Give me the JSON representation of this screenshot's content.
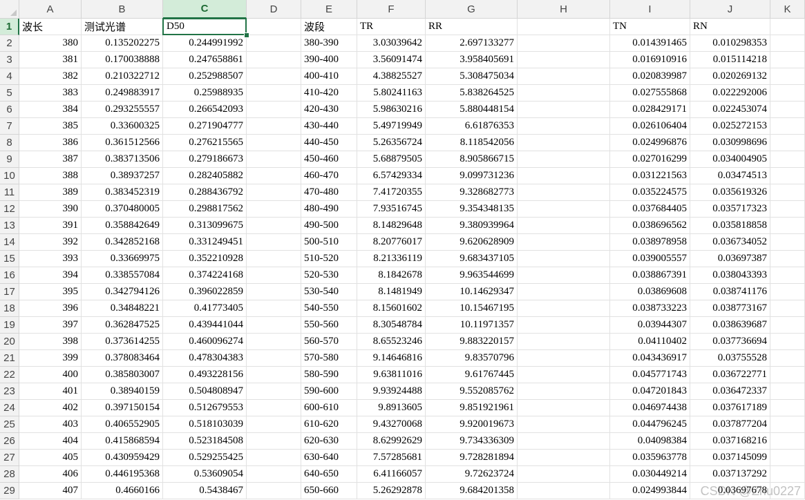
{
  "sheet": {
    "columns": [
      "A",
      "B",
      "C",
      "D",
      "E",
      "F",
      "G",
      "H",
      "I",
      "J",
      "K"
    ],
    "selected_column": "C",
    "selected_row": 1,
    "active_cell": "C1",
    "header_row": [
      "波长",
      "测试光谱",
      "D50",
      "",
      "波段",
      "TR",
      "RR",
      "",
      "TN",
      "RN",
      ""
    ],
    "rows": [
      [
        "380",
        "0.135202275",
        "0.244991992",
        "",
        "380-390",
        "3.03039642",
        "2.697133277",
        "",
        "0.014391465",
        "0.010298353",
        ""
      ],
      [
        "381",
        "0.170038888",
        "0.247658861",
        "",
        "390-400",
        "3.56091474",
        "3.958405691",
        "",
        "0.016910916",
        "0.015114218",
        ""
      ],
      [
        "382",
        "0.210322712",
        "0.252988507",
        "",
        "400-410",
        "4.38825527",
        "5.308475034",
        "",
        "0.020839987",
        "0.020269132",
        ""
      ],
      [
        "383",
        "0.249883917",
        "0.25988935",
        "",
        "410-420",
        "5.80241163",
        "5.838264525",
        "",
        "0.027555868",
        "0.022292006",
        ""
      ],
      [
        "384",
        "0.293255557",
        "0.266542093",
        "",
        "420-430",
        "5.98630216",
        "5.880448154",
        "",
        "0.028429171",
        "0.022453074",
        ""
      ],
      [
        "385",
        "0.33600325",
        "0.271904777",
        "",
        "430-440",
        "5.49719949",
        "6.61876353",
        "",
        "0.026106404",
        "0.025272153",
        ""
      ],
      [
        "386",
        "0.361512566",
        "0.276215565",
        "",
        "440-450",
        "5.26356724",
        "8.118542056",
        "",
        "0.024996876",
        "0.030998696",
        ""
      ],
      [
        "387",
        "0.383713506",
        "0.279186673",
        "",
        "450-460",
        "5.68879505",
        "8.905866715",
        "",
        "0.027016299",
        "0.034004905",
        ""
      ],
      [
        "388",
        "0.38937257",
        "0.282405882",
        "",
        "460-470",
        "6.57429334",
        "9.099731236",
        "",
        "0.031221563",
        "0.03474513",
        ""
      ],
      [
        "389",
        "0.383452319",
        "0.288436792",
        "",
        "470-480",
        "7.41720355",
        "9.328682773",
        "",
        "0.035224575",
        "0.035619326",
        ""
      ],
      [
        "390",
        "0.370480005",
        "0.298817562",
        "",
        "480-490",
        "7.93516745",
        "9.354348135",
        "",
        "0.037684405",
        "0.035717323",
        ""
      ],
      [
        "391",
        "0.358842649",
        "0.313099675",
        "",
        "490-500",
        "8.14829648",
        "9.380939964",
        "",
        "0.038696562",
        "0.035818858",
        ""
      ],
      [
        "392",
        "0.342852168",
        "0.331249451",
        "",
        "500-510",
        "8.20776017",
        "9.620628909",
        "",
        "0.038978958",
        "0.036734052",
        ""
      ],
      [
        "393",
        "0.33669975",
        "0.352210928",
        "",
        "510-520",
        "8.21336119",
        "9.683437105",
        "",
        "0.039005557",
        "0.03697387",
        ""
      ],
      [
        "394",
        "0.338557084",
        "0.374224168",
        "",
        "520-530",
        "8.1842678",
        "9.963544699",
        "",
        "0.038867391",
        "0.038043393",
        ""
      ],
      [
        "395",
        "0.342794126",
        "0.396022859",
        "",
        "530-540",
        "8.1481949",
        "10.14629347",
        "",
        "0.03869608",
        "0.038741176",
        ""
      ],
      [
        "396",
        "0.34848221",
        "0.41773405",
        "",
        "540-550",
        "8.15601602",
        "10.15467195",
        "",
        "0.038733223",
        "0.038773167",
        ""
      ],
      [
        "397",
        "0.362847525",
        "0.439441044",
        "",
        "550-560",
        "8.30548784",
        "10.11971357",
        "",
        "0.03944307",
        "0.038639687",
        ""
      ],
      [
        "398",
        "0.373614255",
        "0.460096274",
        "",
        "560-570",
        "8.65523246",
        "9.883220157",
        "",
        "0.04110402",
        "0.037736694",
        ""
      ],
      [
        "399",
        "0.378083464",
        "0.478304383",
        "",
        "570-580",
        "9.14646816",
        "9.83570796",
        "",
        "0.043436917",
        "0.03755528",
        ""
      ],
      [
        "400",
        "0.385803007",
        "0.493228156",
        "",
        "580-590",
        "9.63811016",
        "9.61767445",
        "",
        "0.045771743",
        "0.036722771",
        ""
      ],
      [
        "401",
        "0.38940159",
        "0.504808947",
        "",
        "590-600",
        "9.93924488",
        "9.552085762",
        "",
        "0.047201843",
        "0.036472337",
        ""
      ],
      [
        "402",
        "0.397150154",
        "0.512679553",
        "",
        "600-610",
        "9.8913605",
        "9.851921961",
        "",
        "0.046974438",
        "0.037617189",
        ""
      ],
      [
        "403",
        "0.406552905",
        "0.518103039",
        "",
        "610-620",
        "9.43270068",
        "9.920019673",
        "",
        "0.044796245",
        "0.037877204",
        ""
      ],
      [
        "404",
        "0.415868594",
        "0.523184508",
        "",
        "620-630",
        "8.62992629",
        "9.734336309",
        "",
        "0.04098384",
        "0.037168216",
        ""
      ],
      [
        "405",
        "0.430959429",
        "0.529255425",
        "",
        "630-640",
        "7.57285681",
        "9.728281894",
        "",
        "0.035963778",
        "0.037145099",
        ""
      ],
      [
        "406",
        "0.446195368",
        "0.53609054",
        "",
        "640-650",
        "6.41166057",
        "9.72623724",
        "",
        "0.030449214",
        "0.037137292",
        ""
      ],
      [
        "407",
        "0.4660166",
        "0.5438467",
        "",
        "650-660",
        "5.26292878",
        "9.684201358",
        "",
        "0.024993844",
        "0.03697678",
        ""
      ]
    ]
  },
  "watermark": "CSDN @Zhu0227",
  "colors": {
    "accent": "#217346",
    "header_bg": "#f2f2f2",
    "selected_header_bg": "#d3ecd9"
  }
}
